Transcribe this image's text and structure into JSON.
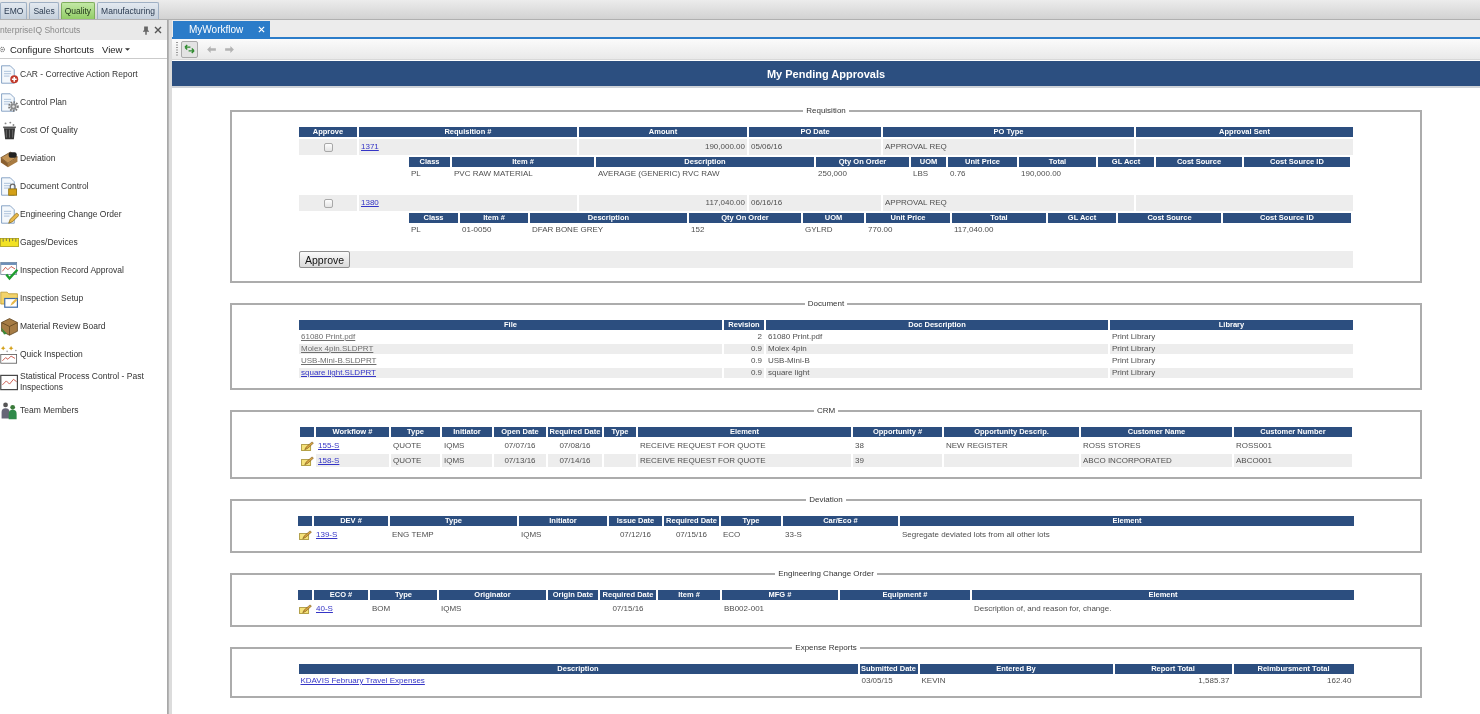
{
  "module_tabs": [
    {
      "label": "EMO",
      "selected": false
    },
    {
      "label": "Sales",
      "selected": false
    },
    {
      "label": "Quality",
      "selected": true
    },
    {
      "label": "Manufacturing",
      "selected": false
    }
  ],
  "shortcuts": {
    "title": "nterpriseIQ Shortcuts",
    "configure_label": "Configure Shortcuts",
    "view_label": "View",
    "items": [
      {
        "label": "CAR - Corrective Action Report"
      },
      {
        "label": "Control Plan"
      },
      {
        "label": "Cost Of Quality"
      },
      {
        "label": "Deviation"
      },
      {
        "label": "Document Control"
      },
      {
        "label": "Engineering Change Order"
      },
      {
        "label": "Gages/Devices"
      },
      {
        "label": "Inspection Record Approval"
      },
      {
        "label": "Inspection Setup"
      },
      {
        "label": "Material Review Board"
      },
      {
        "label": "Quick Inspection"
      },
      {
        "label": "Statistical Process Control - Past Inspections"
      },
      {
        "label": "Team Members"
      }
    ]
  },
  "document_tabs": [
    {
      "label": "MyWorkflow",
      "selected": true
    }
  ],
  "page_title": "My Pending Approvals",
  "sections": [
    {
      "kind": "requisition",
      "title": "Requisition",
      "columns": [
        {
          "label": "Approve",
          "kind": "check"
        },
        {
          "label": "Requisition #",
          "kind": "link"
        },
        {
          "label": "Amount",
          "kind": "number"
        },
        {
          "label": "PO Date",
          "kind": "text"
        },
        {
          "label": "PO Type",
          "kind": "text"
        },
        {
          "label": "Approval Sent",
          "kind": "text"
        }
      ],
      "rows": [
        {
          "checked": false,
          "cells": [
            null,
            "1371",
            "190,000.00",
            "05/06/16",
            "APPROVAL REQ",
            null
          ],
          "lines": {
            "columns": [
              {
                "label": "Class",
                "kind": "text"
              },
              {
                "label": "Item #",
                "kind": "text"
              },
              {
                "label": "Description",
                "kind": "text"
              },
              {
                "label": "Qty On Order",
                "kind": "text"
              },
              {
                "label": "UOM",
                "kind": "text"
              },
              {
                "label": "Unit Price",
                "kind": "text"
              },
              {
                "label": "Total",
                "kind": "text"
              },
              {
                "label": "GL Acct",
                "kind": "text"
              },
              {
                "label": "Cost Source",
                "kind": "text"
              },
              {
                "label": "Cost Source ID",
                "kind": "text"
              }
            ],
            "rows": [
              {
                "cells": [
                  "PL",
                  "PVC RAW MATERIAL",
                  "AVERAGE (GENERIC) RVC RAW",
                  "250,000",
                  "LBS",
                  "0.76",
                  "190,000.00",
                  null,
                  null,
                  null
                ]
              }
            ]
          }
        },
        {
          "checked": false,
          "cells": [
            null,
            "1380",
            "117,040.00",
            "06/16/16",
            "APPROVAL REQ",
            null
          ],
          "lines": {
            "columns": [
              {
                "label": "Class",
                "kind": "text"
              },
              {
                "label": "Item #",
                "kind": "text"
              },
              {
                "label": "Description",
                "kind": "text"
              },
              {
                "label": "Qty On Order",
                "kind": "text"
              },
              {
                "label": "UOM",
                "kind": "text"
              },
              {
                "label": "Unit Price",
                "kind": "text"
              },
              {
                "label": "Total",
                "kind": "text"
              },
              {
                "label": "GL Acct",
                "kind": "text"
              },
              {
                "label": "Cost Source",
                "kind": "text"
              },
              {
                "label": "Cost Source ID",
                "kind": "text"
              }
            ],
            "rows": [
              {
                "cells": [
                  "PL",
                  "01-0050",
                  "DFAR BONE GREY",
                  "152",
                  "GYLRD",
                  "770.00",
                  "117,040.00",
                  null,
                  null,
                  null
                ]
              }
            ]
          }
        }
      ],
      "button": "Approve"
    },
    {
      "kind": "document",
      "title": "Document",
      "columns": [
        {
          "label": "File",
          "kind": "link"
        },
        {
          "label": "Revision",
          "kind": "number"
        },
        {
          "label": "Doc Description",
          "kind": "text"
        },
        {
          "label": "Library",
          "kind": "text"
        }
      ],
      "rows": [
        {
          "visited": true,
          "cells": [
            "61080 Print.pdf",
            "2",
            "61080 Print.pdf",
            "Print Library"
          ]
        },
        {
          "visited": true,
          "cells": [
            "Molex 4pin.SLDPRT",
            "0.9",
            "Molex 4pin",
            "Print Library"
          ]
        },
        {
          "visited": true,
          "cells": [
            "USB-Mini-B.SLDPRT",
            "0.9",
            "USB-Mini-B",
            "Print Library"
          ]
        },
        {
          "visited": false,
          "cells": [
            "square light.SLDPRT",
            "0.9",
            "square light",
            "Print Library"
          ]
        }
      ]
    },
    {
      "kind": "crm",
      "title": "CRM",
      "columns": [
        {
          "kind": "icon"
        },
        {
          "label": "Workflow #",
          "kind": "link"
        },
        {
          "label": "Type",
          "kind": "text"
        },
        {
          "label": "Initiator",
          "kind": "text"
        },
        {
          "label": "Open Date",
          "kind": "date"
        },
        {
          "label": "Required Date",
          "kind": "date"
        },
        {
          "label": "Type",
          "kind": "text"
        },
        {
          "label": "Element",
          "kind": "text"
        },
        {
          "label": "Opportunity #",
          "kind": "text"
        },
        {
          "label": "Opportunity Descrip.",
          "kind": "text"
        },
        {
          "label": "Customer Name",
          "kind": "text"
        },
        {
          "label": "Customer Number",
          "kind": "text"
        }
      ],
      "rows": [
        {
          "cells": [
            null,
            "155-S",
            "QUOTE",
            "IQMS",
            "07/07/16",
            "07/08/16",
            null,
            "RECEIVE REQUEST FOR QUOTE",
            "38",
            "NEW REGISTER",
            "ROSS STORES",
            "ROSS001"
          ]
        },
        {
          "cells": [
            null,
            "158-S",
            "QUOTE",
            "IQMS",
            "07/13/16",
            "07/14/16",
            null,
            "RECEIVE REQUEST FOR QUOTE",
            "39",
            null,
            "ABCO INCORPORATED",
            "ABCO001"
          ]
        }
      ]
    },
    {
      "kind": "deviation",
      "title": "Deviation",
      "columns": [
        {
          "kind": "icon"
        },
        {
          "label": "DEV #",
          "kind": "link"
        },
        {
          "label": "Type",
          "kind": "text"
        },
        {
          "label": "Initiator",
          "kind": "text"
        },
        {
          "label": "Issue Date",
          "kind": "date"
        },
        {
          "label": "Required Date",
          "kind": "date"
        },
        {
          "label": "Type",
          "kind": "text"
        },
        {
          "label": "Car/Eco #",
          "kind": "text"
        },
        {
          "label": "Element",
          "kind": "text"
        }
      ],
      "rows": [
        {
          "cells": [
            null,
            "139-S",
            "ENG TEMP",
            "IQMS",
            "07/12/16",
            "07/15/16",
            "ECO",
            "33-S",
            "Segregate deviated lots from all other lots"
          ]
        }
      ]
    },
    {
      "kind": "eco",
      "title": "Engineering Change Order",
      "columns": [
        {
          "kind": "icon"
        },
        {
          "label": "ECO #",
          "kind": "link"
        },
        {
          "label": "Type",
          "kind": "text"
        },
        {
          "label": "Originator",
          "kind": "text"
        },
        {
          "label": "Origin Date",
          "kind": "date"
        },
        {
          "label": "Required Date",
          "kind": "date"
        },
        {
          "label": "Item #",
          "kind": "text"
        },
        {
          "label": "MFG #",
          "kind": "text"
        },
        {
          "label": "Equipment #",
          "kind": "text"
        },
        {
          "label": "Element",
          "kind": "text"
        }
      ],
      "rows": [
        {
          "cells": [
            null,
            "40-S",
            "BOM",
            "IQMS",
            null,
            "07/15/16",
            null,
            "BB002-001",
            null,
            "Description of, and reason for, change."
          ]
        }
      ]
    },
    {
      "kind": "expense",
      "title": "Expense Reports",
      "columns": [
        {
          "label": "Description",
          "kind": "link"
        },
        {
          "label": "Submitted Date",
          "kind": "text"
        },
        {
          "label": "Entered By",
          "kind": "text"
        },
        {
          "label": "Report Total",
          "kind": "number"
        },
        {
          "label": "Reimbursment Total",
          "kind": "number"
        }
      ],
      "rows": [
        {
          "cells": [
            "KDAVIS February Travel Expenses",
            "03/05/15",
            "KEVIN",
            "1,585.37",
            "162.40"
          ]
        }
      ]
    }
  ]
}
